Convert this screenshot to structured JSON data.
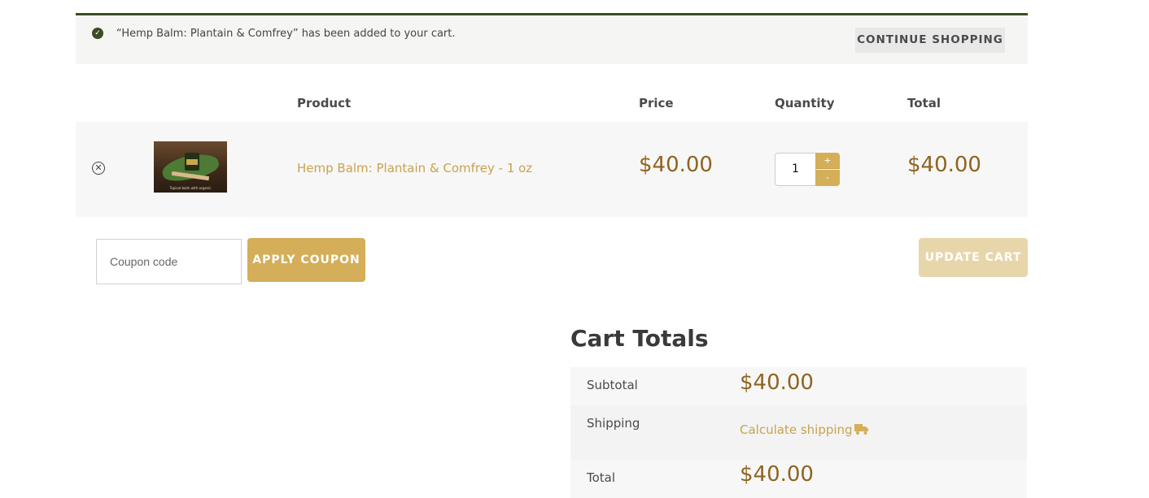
{
  "notice": {
    "message": "“Hemp Balm: Plantain & Comfrey” has been added to your cart.",
    "continue_label": "CONTINUE SHOPPING",
    "check_glyph": "✓"
  },
  "table": {
    "headers": {
      "product": "Product",
      "price": "Price",
      "quantity": "Quantity",
      "total": "Total"
    },
    "items": [
      {
        "remove_glyph": "✕",
        "name": "Hemp Balm: Plantain & Comfrey - 1 oz",
        "price": "$40.00",
        "quantity": "1",
        "total": "$40.00",
        "thumb_caption": "Topical balm with organic"
      }
    ],
    "qty_plus": "+",
    "qty_minus": "-"
  },
  "actions": {
    "coupon_placeholder": "Coupon code",
    "apply_label": "APPLY COUPON",
    "update_label": "UPDATE CART"
  },
  "totals": {
    "title": "Cart Totals",
    "subtotal_label": "Subtotal",
    "subtotal_value": "$40.00",
    "shipping_label": "Shipping",
    "shipping_link": "Calculate shipping",
    "total_label": "Total",
    "total_value": "$40.00"
  },
  "colors": {
    "accent_gold": "#d4ae58",
    "price_brown": "#8f6420",
    "notice_border": "#3c4c24"
  }
}
